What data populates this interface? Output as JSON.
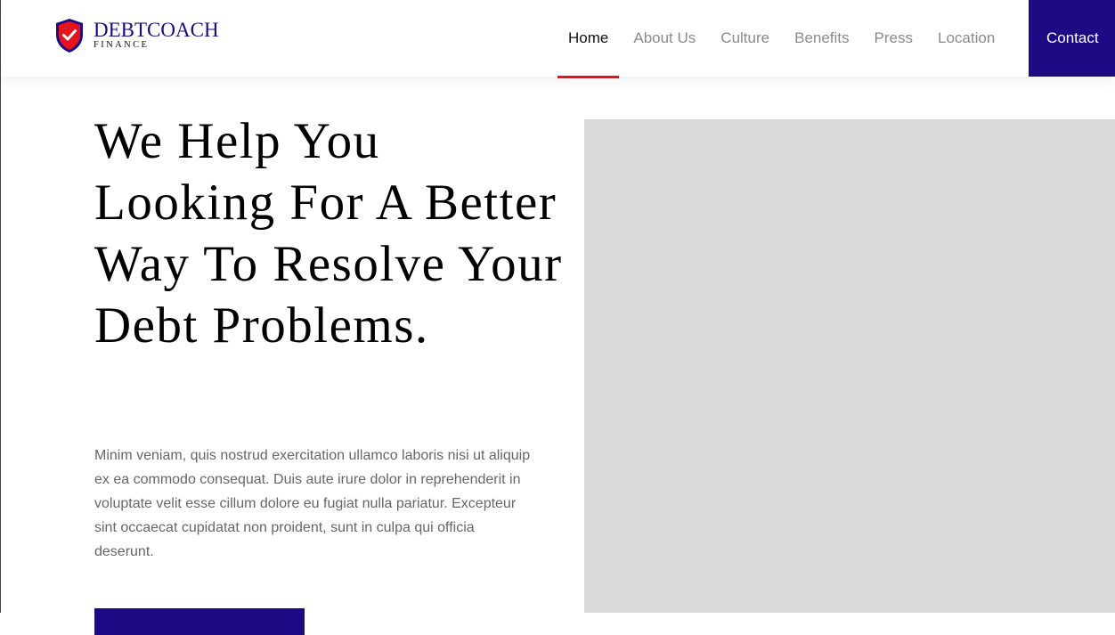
{
  "brand": {
    "name": "DEBTCOACH",
    "tagline": "FINANCE",
    "colors": {
      "primary": "#1d0a84",
      "accent": "#e5141c"
    }
  },
  "nav": {
    "items": [
      {
        "label": "Home",
        "active": true
      },
      {
        "label": "About Us",
        "active": false
      },
      {
        "label": "Culture",
        "active": false
      },
      {
        "label": "Benefits",
        "active": false
      },
      {
        "label": "Press",
        "active": false
      },
      {
        "label": "Location",
        "active": false
      }
    ],
    "contact_label": "Contact"
  },
  "hero": {
    "title": "We Help You Looking For A Better Way To Resolve Your Debt Problems.",
    "body": "Minim veniam, quis nostrud exercitation ullamco laboris nisi ut aliquip ex ea commodo consequat. Duis aute irure dolor in reprehenderit in voluptate velit esse cillum dolore eu fugiat nulla pariatur. Excepteur sint occaecat cupidatat non proident, sunt in culpa qui officia deserunt.",
    "image_icon": "image-placeholder"
  }
}
